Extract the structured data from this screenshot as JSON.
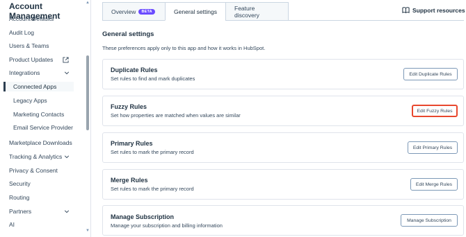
{
  "sidebar": {
    "title": "Account Management",
    "items": [
      {
        "label": "Account Defaults"
      },
      {
        "label": "Audit Log"
      },
      {
        "label": "Users & Teams"
      },
      {
        "label": "Product Updates"
      },
      {
        "label": "Integrations"
      },
      {
        "label": "Connected Apps"
      },
      {
        "label": "Legacy Apps"
      },
      {
        "label": "Marketing Contacts"
      },
      {
        "label": "Email Service Provider"
      },
      {
        "label": "Marketplace Downloads"
      },
      {
        "label": "Tracking & Analytics"
      },
      {
        "label": "Privacy & Consent"
      },
      {
        "label": "Security"
      },
      {
        "label": "Routing"
      },
      {
        "label": "Partners"
      },
      {
        "label": "AI"
      }
    ]
  },
  "tabs": [
    {
      "label": "Overview",
      "badge": "BETA"
    },
    {
      "label": "General settings"
    },
    {
      "label": "Feature discovery"
    }
  ],
  "support_label": "Support resources",
  "section": {
    "title": "General settings",
    "description": "These preferences apply only to this app and how it works in HubSpot."
  },
  "cards": [
    {
      "title": "Duplicate Rules",
      "description": "Set rules to find and mark duplicates",
      "button": "Edit Duplicate Rules"
    },
    {
      "title": "Fuzzy Rules",
      "description": "Set how properties are matched when values are similar",
      "button": "Edit Fuzzy Rules"
    },
    {
      "title": "Primary Rules",
      "description": "Set rules to mark the primary record",
      "button": "Edit Primary Rules"
    },
    {
      "title": "Merge Rules",
      "description": "Set rules to mark the primary record",
      "button": "Edit Merge Rules"
    },
    {
      "title": "Manage Subscription",
      "description": "Manage your subscription and billing information",
      "button": "Manage Subscription"
    }
  ],
  "colors": {
    "accent_badge": "#6a4bff",
    "highlight": "#e8472d",
    "text_dark": "#213343"
  }
}
